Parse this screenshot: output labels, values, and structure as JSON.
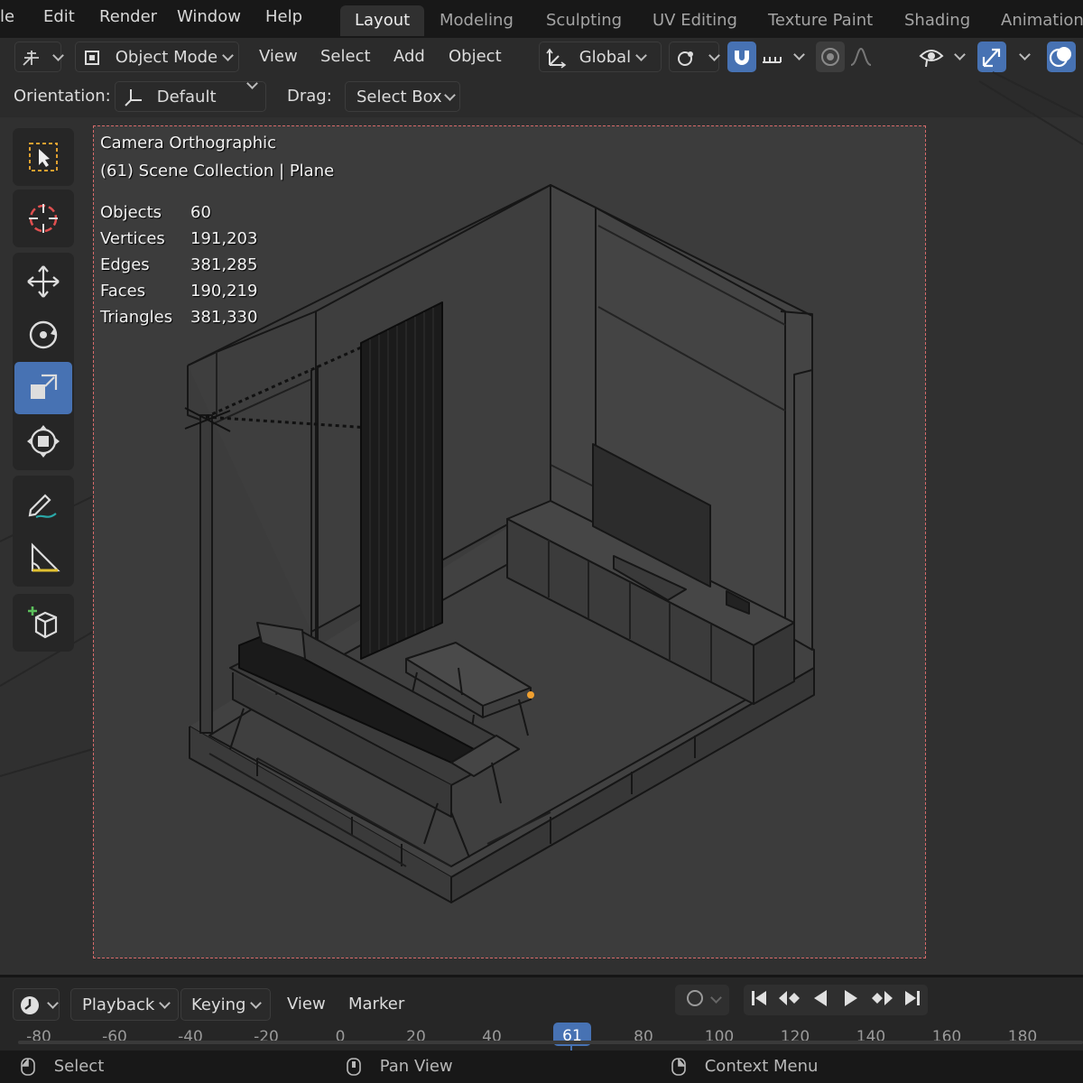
{
  "topbar": {
    "menus": [
      "File",
      "Edit",
      "Render",
      "Window",
      "Help"
    ],
    "workspaces": [
      "Layout",
      "Modeling",
      "Sculpting",
      "UV Editing",
      "Texture Paint",
      "Shading",
      "Animation"
    ],
    "active_workspace": "Layout"
  },
  "header": {
    "mode": "Object Mode",
    "menus": [
      "View",
      "Select",
      "Add",
      "Object"
    ],
    "transform_orientation": "Global"
  },
  "tool_options": {
    "orientation_label": "Orientation:",
    "orientation_value": "Default",
    "drag_label": "Drag:",
    "drag_value": "Select Box"
  },
  "viewport": {
    "camera_label": "Camera Orthographic",
    "collection_label": "(61) Scene Collection | Plane",
    "stats": [
      {
        "label": "Objects",
        "value": "60"
      },
      {
        "label": "Vertices",
        "value": "191,203"
      },
      {
        "label": "Edges",
        "value": "381,285"
      },
      {
        "label": "Faces",
        "value": "190,219"
      },
      {
        "label": "Triangles",
        "value": "381,330"
      }
    ]
  },
  "toolbar": {
    "tools": [
      "select-box",
      "cursor",
      "move",
      "rotate",
      "scale",
      "transform",
      "annotate",
      "measure",
      "add-cube"
    ],
    "active_tool": "scale"
  },
  "timeline": {
    "menus": [
      "Playback",
      "Keying",
      "View",
      "Marker"
    ],
    "current_frame": "61",
    "ruler": [
      "-80",
      "-60",
      "-40",
      "-20",
      "0",
      "20",
      "40",
      "80",
      "100",
      "120",
      "140",
      "160",
      "180"
    ]
  },
  "statusbar": {
    "items": [
      "Select",
      "Pan View",
      "Context Menu"
    ]
  },
  "colors": {
    "accent": "#4772b3",
    "camera_border": "#d86a6a",
    "origin": "#f0a030"
  }
}
